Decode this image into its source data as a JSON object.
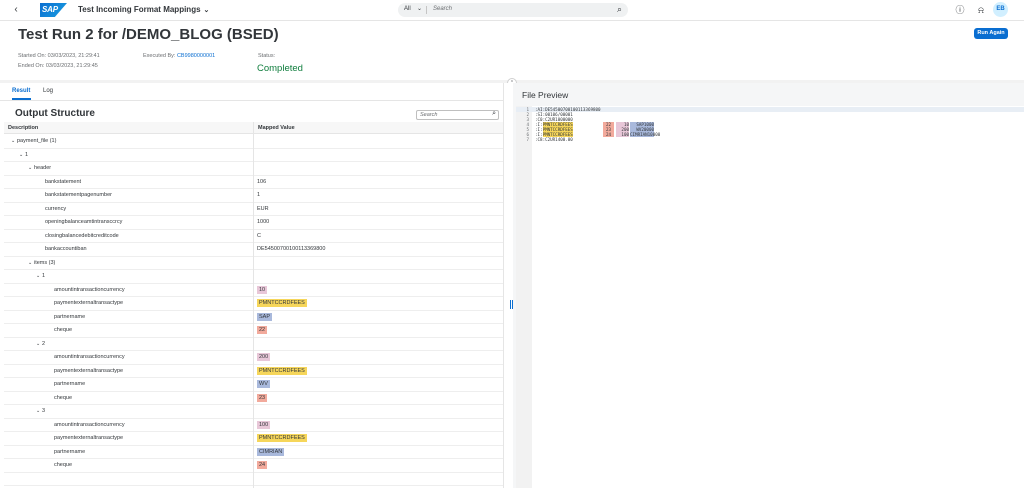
{
  "shell": {
    "logo_text": "SAP",
    "app_title": "Test Incoming Format Mappings",
    "search_scope": "All",
    "search_placeholder": "Search",
    "user_initials": "EB"
  },
  "header": {
    "title": "Test Run 2 for /DEMO_BLOG (BSED)",
    "run_again_label": "Run Again",
    "started_on": "Started On: 03/03/2023, 21:29:41",
    "ended_on": "Ended On: 03/03/2023, 21:29:45",
    "executed_by_label": "Executed By:",
    "executed_by_value": "CB9980000001",
    "status_label": "Status:",
    "status_value": "Completed"
  },
  "tabs": [
    {
      "label": "Result",
      "active": true
    },
    {
      "label": "Log",
      "active": false
    }
  ],
  "output": {
    "title": "Output Structure",
    "search_placeholder": "Search",
    "col_description": "Description",
    "col_mapped_value": "Mapped Value",
    "rows": [
      {
        "label": "payment_file (1)",
        "value": "",
        "level": 0,
        "expandable": true
      },
      {
        "label": "1",
        "value": "",
        "level": 1,
        "expandable": true
      },
      {
        "label": "header",
        "value": "",
        "level": 2,
        "expandable": true
      },
      {
        "label": "bankstatement",
        "value": "106",
        "level": 3,
        "expandable": false
      },
      {
        "label": "bankstatementpagenumber",
        "value": "1",
        "level": 3,
        "expandable": false
      },
      {
        "label": "currency",
        "value": "EUR",
        "level": 3,
        "expandable": false
      },
      {
        "label": "openingbalanceamtintransccrcy",
        "value": "1000",
        "level": 3,
        "expandable": false
      },
      {
        "label": "closingbalancedebitcreditcode",
        "value": "C",
        "level": 3,
        "expandable": false
      },
      {
        "label": "bankaccountiban",
        "value": "DE54500700100113369800",
        "level": 3,
        "expandable": false
      },
      {
        "label": "items (3)",
        "value": "",
        "level": 2,
        "expandable": true
      },
      {
        "label": "1",
        "value": "",
        "level": 3,
        "expandable": true
      },
      {
        "label": "amountintransactioncurrency",
        "value": "10",
        "level": 4,
        "expandable": false,
        "highlight": "#e8c7d8"
      },
      {
        "label": "paymentexternaltransactype",
        "value": "PMNTCCRDFEES",
        "level": 4,
        "expandable": false,
        "highlight": "#f6d65a"
      },
      {
        "label": "partnername",
        "value": "SAP",
        "level": 4,
        "expandable": false,
        "highlight": "#a9b9dc"
      },
      {
        "label": "cheque",
        "value": "22",
        "level": 4,
        "expandable": false,
        "highlight": "#f2aa9c"
      },
      {
        "label": "2",
        "value": "",
        "level": 3,
        "expandable": true
      },
      {
        "label": "amountintransactioncurrency",
        "value": "200",
        "level": 4,
        "expandable": false,
        "highlight": "#e8c7d8"
      },
      {
        "label": "paymentexternaltransactype",
        "value": "PMNTCCRDFEES",
        "level": 4,
        "expandable": false,
        "highlight": "#f6d65a"
      },
      {
        "label": "partnername",
        "value": "WV",
        "level": 4,
        "expandable": false,
        "highlight": "#a9b9dc"
      },
      {
        "label": "cheque",
        "value": "23",
        "level": 4,
        "expandable": false,
        "highlight": "#f2aa9c"
      },
      {
        "label": "3",
        "value": "",
        "level": 3,
        "expandable": true
      },
      {
        "label": "amountintransactioncurrency",
        "value": "100",
        "level": 4,
        "expandable": false,
        "highlight": "#e8c7d8"
      },
      {
        "label": "paymentexternaltransactype",
        "value": "PMNTCCRDFEES",
        "level": 4,
        "expandable": false,
        "highlight": "#f6d65a"
      },
      {
        "label": "partnername",
        "value": "CIMRIAN",
        "level": 4,
        "expandable": false,
        "highlight": "#a9b9dc"
      },
      {
        "label": "cheque",
        "value": "24",
        "level": 4,
        "expandable": false,
        "highlight": "#f2aa9c"
      },
      {
        "label": "",
        "value": "",
        "level": 0,
        "expandable": false
      }
    ]
  },
  "preview": {
    "title": "File Preview",
    "lines": [
      {
        "no": "1",
        "text": ":AI:DE54500700100113369800"
      },
      {
        "no": "2",
        "text": ":SI:00106/00001"
      },
      {
        "no": "3",
        "text": ":C0:C2UR1000000"
      },
      {
        "no": "4",
        "text": ":I:",
        "hl": "PMNTCCRDFEES",
        "cheque": "22",
        "amount": "10",
        "partner": "SAP1000"
      },
      {
        "no": "5",
        "text": ":I:",
        "hl": "PMNTCCRDFEES",
        "cheque": "23",
        "amount": "200",
        "partner": "WV20000"
      },
      {
        "no": "6",
        "text": ":I:",
        "hl": "PMNTCCRDFEES",
        "cheque": "24",
        "amount": "100",
        "partner": "CIMRIAN10000"
      },
      {
        "no": "7",
        "text": ":C8:C2UR1400.00"
      }
    ]
  },
  "colors": {
    "accent": "#0a6ed1",
    "status_green": "#107e3e",
    "hl_amount": "#e8c7d8",
    "hl_type": "#f6d65a",
    "hl_partner": "#a9b9dc",
    "hl_cheque": "#f2aa9c"
  }
}
